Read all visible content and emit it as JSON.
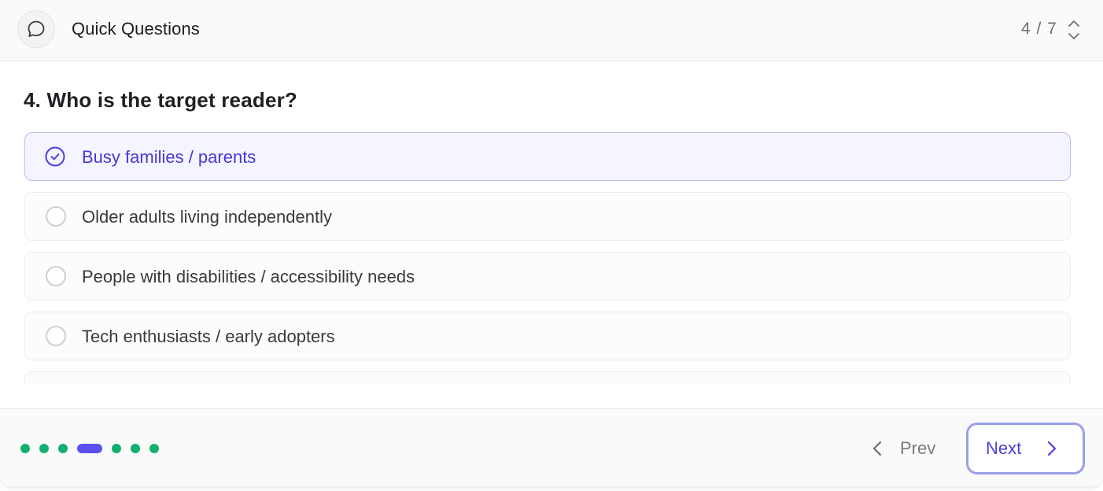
{
  "header": {
    "title": "Quick Questions",
    "counter": "4 / 7",
    "chat_icon": "chat-bubble-icon",
    "nav_icon": "chevron-up-down-icon"
  },
  "question": {
    "text": "4. Who is the target reader?"
  },
  "options": [
    {
      "label": "Busy families / parents",
      "selected": true
    },
    {
      "label": "Older adults living independently",
      "selected": false
    },
    {
      "label": "People with disabilities / accessibility needs",
      "selected": false
    },
    {
      "label": "Tech enthusiasts / early adopters",
      "selected": false
    },
    {
      "label": "",
      "selected": false
    }
  ],
  "progress": {
    "total": 7,
    "current": 4,
    "completed_color": "#10b070",
    "active_color": "#5b4ff0"
  },
  "footer": {
    "prev_label": "Prev",
    "next_label": "Next"
  },
  "colors": {
    "accent": "#4a3fe0",
    "selected_bg": "#f4f5ff",
    "selected_border": "#b9bdf3"
  }
}
